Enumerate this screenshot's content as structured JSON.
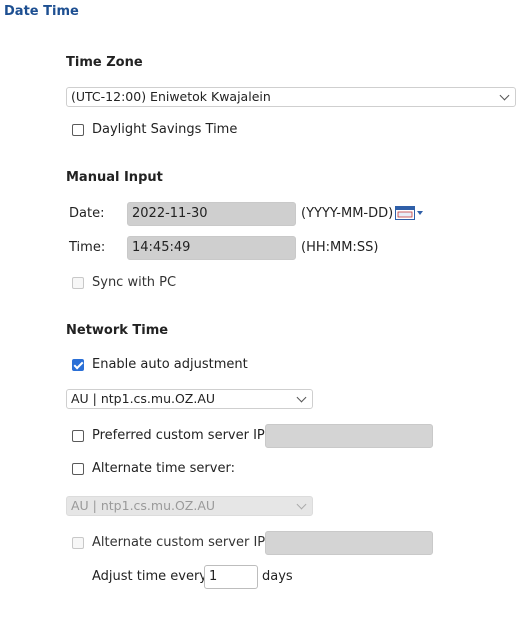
{
  "page": {
    "title": "Date Time"
  },
  "timezone": {
    "heading": "Time Zone",
    "selected": "(UTC-12:00) Eniwetok Kwajalein",
    "dst_label": "Daylight Savings Time",
    "dst_checked": false
  },
  "manual": {
    "heading": "Manual Input",
    "date_label": "Date:",
    "date_value": "2022-11-30",
    "date_format": "(YYYY-MM-DD)",
    "time_label": "Time:",
    "time_value": "14:45:49",
    "time_format": "(HH:MM:SS)",
    "sync_label": "Sync with PC",
    "sync_checked": false
  },
  "network": {
    "heading": "Network Time",
    "enable_label": "Enable auto adjustment",
    "enable_checked": true,
    "server_selected": "AU | ntp1.cs.mu.OZ.AU",
    "preferred_label": "Preferred custom server IP:",
    "preferred_value": "",
    "alternate_label": "Alternate time server:",
    "alternate_server_selected": "AU | ntp1.cs.mu.OZ.AU",
    "alternate_custom_label": "Alternate custom server IP:",
    "alternate_custom_value": "",
    "adjust_prefix": "Adjust time every",
    "adjust_value": "1",
    "adjust_suffix": "days"
  },
  "colors": {
    "title": "#1d4f91",
    "checkbox_checked": "#2a6fd6",
    "field_bg": "#cfcfcf"
  },
  "icons": {
    "calendar": "calendar-dropdown-icon",
    "chevron": "chevron-down-icon"
  }
}
